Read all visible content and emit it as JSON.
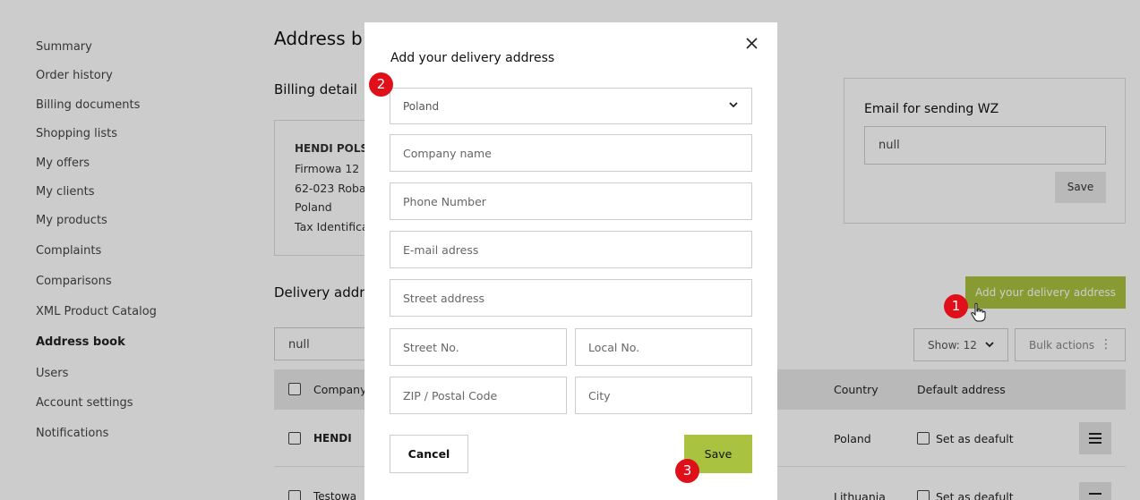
{
  "sidebar": {
    "items": [
      {
        "label": "Summary"
      },
      {
        "label": "Order history"
      },
      {
        "label": "Billing documents"
      },
      {
        "label": "Shopping lists"
      },
      {
        "label": "My offers"
      },
      {
        "label": "My clients"
      },
      {
        "label": "My products"
      },
      {
        "label": "Complaints"
      },
      {
        "label": "Comparisons"
      },
      {
        "label": "XML Product Catalog"
      },
      {
        "label": "Address book"
      },
      {
        "label": "Users"
      },
      {
        "label": "Account settings"
      },
      {
        "label": "Notifications"
      }
    ],
    "active": "Address book"
  },
  "main": {
    "title": "Address b",
    "billing_title": "Billing detail",
    "billing": {
      "name": "HENDI POLSI",
      "street": "Firmowa 12",
      "city": "62-023 Roba",
      "country": "Poland",
      "tax": "Tax Identifica"
    },
    "email_card": {
      "title": "Email for sending WZ",
      "value": "null",
      "save_label": "Save"
    },
    "delivery_title": "Delivery addr",
    "add_delivery_label": "Add your delivery address",
    "search_value": "null",
    "show_label": "Show: 12",
    "bulk_label": "Bulk actions",
    "table": {
      "headers": {
        "company": "Company",
        "country": "Country",
        "default": "Default address"
      },
      "rows": [
        {
          "company": "HENDI",
          "country": "Poland",
          "default": "Set as deafult"
        },
        {
          "company": "Testowa",
          "country": "Lithuania",
          "default": "Set as deafult"
        }
      ]
    }
  },
  "modal": {
    "title": "Add your delivery address",
    "country_value": "Poland",
    "placeholders": {
      "company": "Company name",
      "phone": "Phone Number",
      "email": "E-mail adress",
      "street": "Street address",
      "street_no": "Street No.",
      "local_no": "Local No.",
      "zip": "ZIP / Postal Code",
      "city": "City"
    },
    "cancel_label": "Cancel",
    "save_label": "Save"
  },
  "steps": {
    "one": "1",
    "two": "2",
    "three": "3"
  },
  "colors": {
    "accent": "#a9c23f",
    "badge": "#e0101a"
  }
}
